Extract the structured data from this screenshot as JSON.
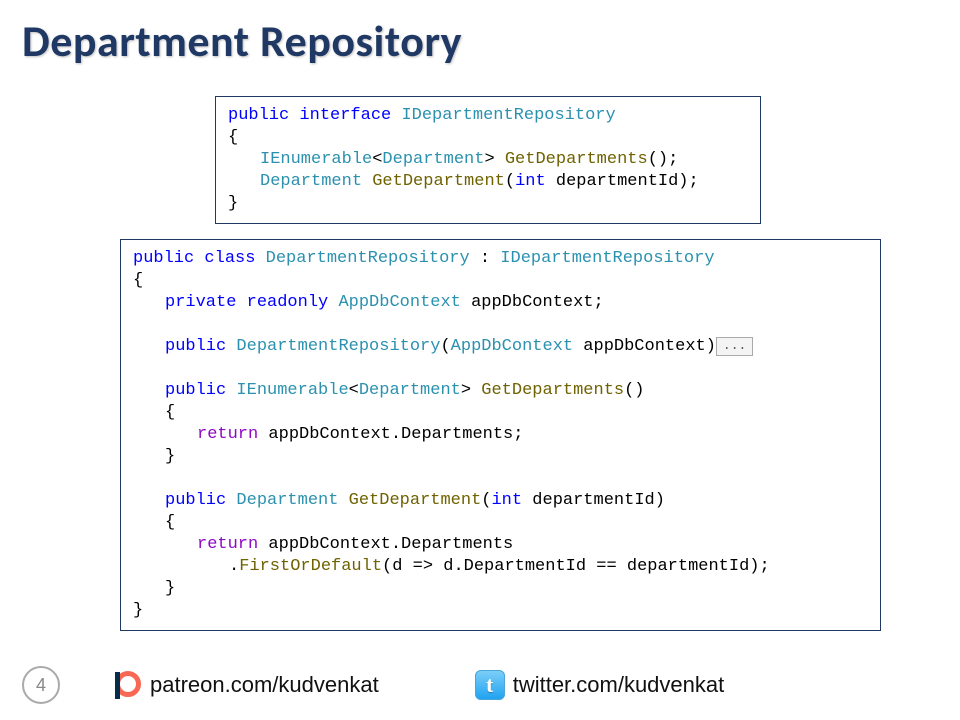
{
  "title": "Department Repository",
  "interface": {
    "decl": {
      "kw1": "public",
      "kw2": "interface",
      "name": "IDepartmentRepository"
    },
    "m1": {
      "ret1": "IEnumerable",
      "ret2": "Department",
      "name": "GetDepartments"
    },
    "m2": {
      "ret": "Department",
      "name": "GetDepartment",
      "pk": "int",
      "pn": "departmentId"
    }
  },
  "class": {
    "decl": {
      "kw1": "public",
      "kw2": "class",
      "name": "DepartmentRepository",
      "base": "IDepartmentRepository"
    },
    "field": {
      "kw1": "private",
      "kw2": "readonly",
      "type": "AppDbContext",
      "name": "appDbContext"
    },
    "ctor": {
      "kw": "public",
      "name": "DepartmentRepository",
      "ptype": "AppDbContext",
      "pname": "appDbContext"
    },
    "fold": "...",
    "m1": {
      "kw": "public",
      "ret1": "IEnumerable",
      "ret2": "Department",
      "name": "GetDepartments",
      "rkw": "return",
      "body": "appDbContext.Departments"
    },
    "m2": {
      "kw": "public",
      "ret": "Department",
      "name": "GetDepartment",
      "pk": "int",
      "pn": "departmentId",
      "rkw": "return",
      "l1": "appDbContext.Departments",
      "l2a": ".",
      "l2b": "FirstOrDefault",
      "l2c": "(d => d.DepartmentId == departmentId);"
    }
  },
  "footer": {
    "page": "4",
    "patreon": "patreon.com/kudvenkat",
    "twitter": "twitter.com/kudvenkat",
    "twitter_glyph": "t"
  }
}
